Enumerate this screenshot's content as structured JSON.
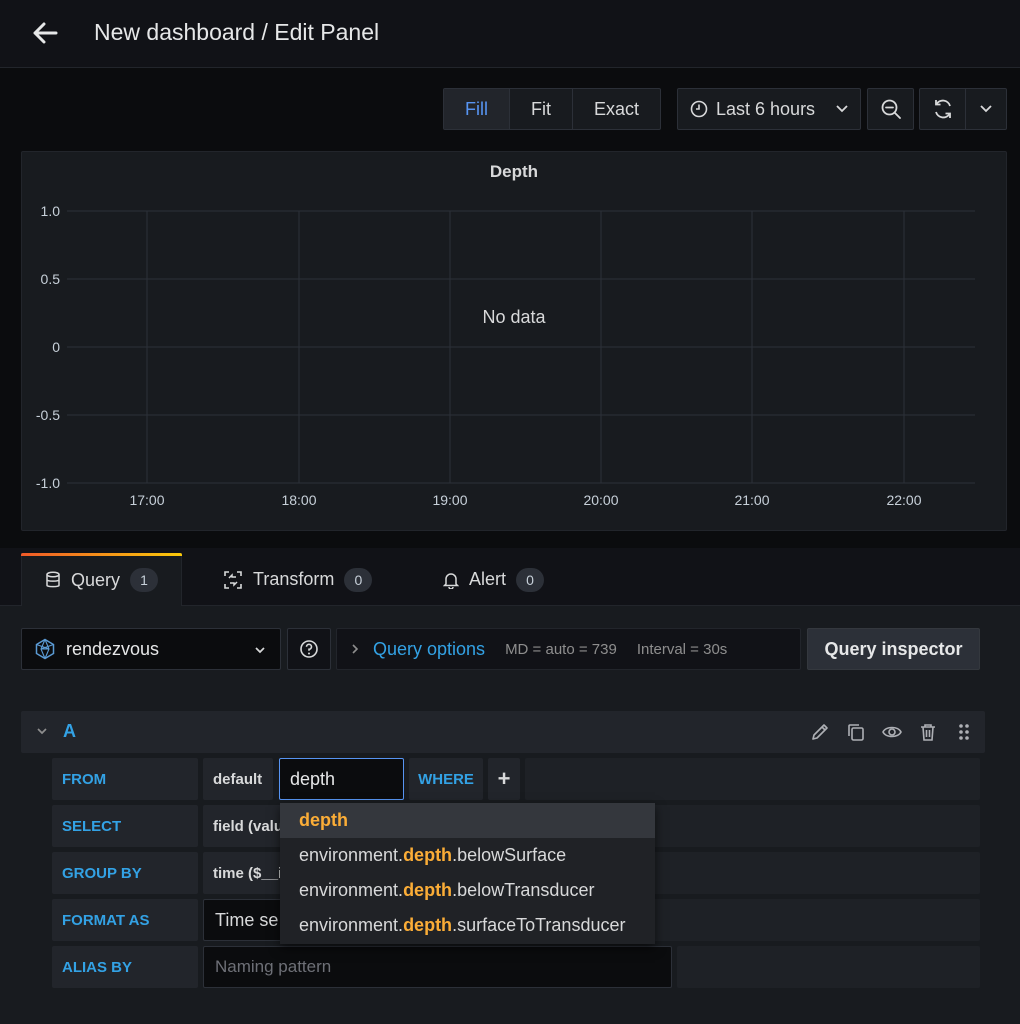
{
  "header": {
    "title": "New dashboard / Edit Panel"
  },
  "toolbar": {
    "view_modes": [
      "Fill",
      "Fit",
      "Exact"
    ],
    "active_view_mode": "Fill",
    "time_range": "Last 6 hours"
  },
  "panel": {
    "title": "Depth",
    "no_data": "No data"
  },
  "chart_data": {
    "type": "line",
    "title": "Depth",
    "x": [
      "17:00",
      "18:00",
      "19:00",
      "20:00",
      "21:00",
      "22:00"
    ],
    "y_ticks": [
      "1.0",
      "0.5",
      "0",
      "-0.5",
      "-1.0"
    ],
    "ylim": [
      -1.0,
      1.0
    ],
    "series": [],
    "grid": true
  },
  "tabs": [
    {
      "label": "Query",
      "count": "1",
      "icon": "database-icon"
    },
    {
      "label": "Transform",
      "count": "0",
      "icon": "transform-icon"
    },
    {
      "label": "Alert",
      "count": "0",
      "icon": "bell-icon"
    }
  ],
  "datasource": {
    "name": "rendezvous"
  },
  "query_options": {
    "label": "Query options",
    "md": "MD = auto = 739",
    "interval": "Interval = 30s"
  },
  "query_inspector": "Query inspector",
  "query": {
    "ref_id": "A",
    "from_label": "FROM",
    "policy": "default",
    "measurement": "depth",
    "where_label": "WHERE",
    "add_label": "+",
    "select_label": "SELECT",
    "select_value": "field (valu",
    "group_by_label": "GROUP BY",
    "group_by_value": "time ($__i",
    "format_as_label": "FORMAT AS",
    "format_as_value": "Time se",
    "alias_by_label": "ALIAS BY",
    "alias_placeholder": "Naming pattern"
  },
  "suggestions": [
    {
      "prefix": "",
      "match": "depth",
      "suffix": ""
    },
    {
      "prefix": "environment.",
      "match": "depth",
      "suffix": ".belowSurface"
    },
    {
      "prefix": "environment.",
      "match": "depth",
      "suffix": ".belowTransducer"
    },
    {
      "prefix": "environment.",
      "match": "depth",
      "suffix": ".surfaceToTransducer"
    }
  ]
}
